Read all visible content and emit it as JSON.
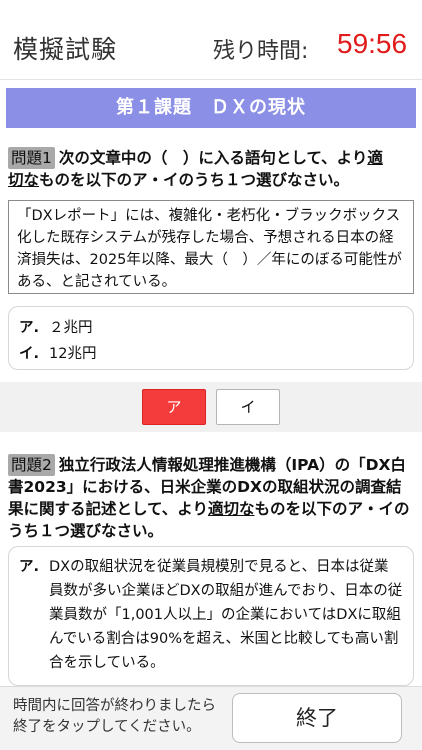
{
  "header": {
    "app_title": "模擬試験",
    "timer_label": "残り時間:",
    "timer_value": "59:56",
    "timer_color": "#e11b1b"
  },
  "section": {
    "title": "第１課題　ＤＸの現状",
    "color": "#8b8fe6"
  },
  "question1": {
    "label": "問題1",
    "text_a": "次の文章中の（　）に入る語句として、より",
    "text_u1": "適",
    "text_u2": "切な",
    "text_b": "ものを以下のア・イのうち１つ選びなさい。",
    "passage": "「DXレポート」には、複雑化・老朽化・ブラックボックス化した既存システムが残存した場合、予想される日本の経済損失は、2025年以降、最大（　）／年にのぼる可能性がある、と記されている。",
    "options": [
      {
        "key": "ア.",
        "text": "２兆円"
      },
      {
        "key": "イ.",
        "text": "12兆円"
      }
    ],
    "answers": [
      "ア",
      "イ"
    ],
    "selected": "ア",
    "selected_color": "#f53c3c"
  },
  "question2": {
    "label": "問題2",
    "text_a": "独立行政法人情報処理推進機構（IPA）の「DX白書2023」における、日米企業のDXの取組状況の調査結果に関する記述として、より",
    "text_u": "適切な",
    "text_b": "ものを以下のア・イのうち１つ選びなさい。",
    "option_key": "ア.",
    "option_text": "DXの取組状況を従業員規模別で見ると、日本は従業員数が多い企業ほどDXの取組が進んでおり、日本の従業員数が「1,001人以上」の企業においてはDXに取組んでいる割合は90%を超え、米国と比較しても高い割合を示している。"
  },
  "footer": {
    "note_line1": "時間内に回答が終わりましたら",
    "note_line2": "終了をタップしてください。",
    "finish_label": "終了"
  }
}
